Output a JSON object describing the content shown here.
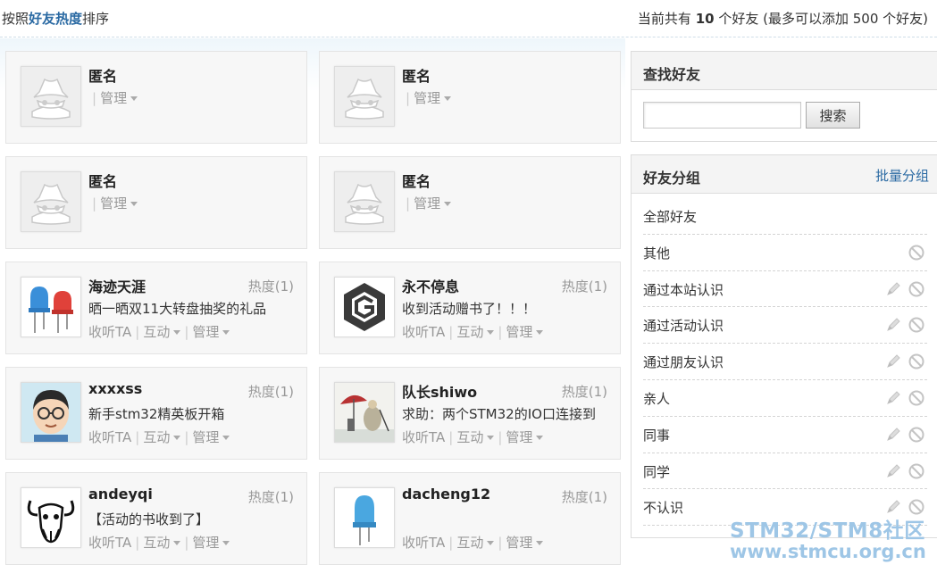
{
  "sort_bar": {
    "prefix": "按照",
    "highlight": "好友热度",
    "suffix": "排序",
    "count_prefix": "当前共有 ",
    "count": "10",
    "count_suffix": " 个好友 (最多可以添加 500 个好友)"
  },
  "labels": {
    "listen": "收听TA",
    "interact": "互动",
    "manage": "管理"
  },
  "friends": [
    {
      "name": "匿名",
      "heat": "",
      "status": "",
      "avatar": "anonymous-icon"
    },
    {
      "name": "匿名",
      "heat": "",
      "status": "",
      "avatar": "anonymous-icon"
    },
    {
      "name": "匿名",
      "heat": "",
      "status": "",
      "avatar": "anonymous-icon"
    },
    {
      "name": "匿名",
      "heat": "",
      "status": "",
      "avatar": "anonymous-icon"
    },
    {
      "name": "海迹天涯",
      "heat": "热度(1)",
      "status": "晒一晒双11大转盘抽奖的礼品",
      "avatar": "led-pair-icon"
    },
    {
      "name": "永不停息",
      "heat": "热度(1)",
      "status": "收到活动赠书了！！！",
      "avatar": "g-logo-icon"
    },
    {
      "name": "xxxxss",
      "heat": "热度(1)",
      "status": "新手stm32精英板开箱",
      "avatar": "cartoon-face-icon"
    },
    {
      "name": "队长shiwo",
      "heat": "热度(1)",
      "status": "求助：两个STM32的IO口连接到",
      "avatar": "umbrella-scene-icon"
    },
    {
      "name": "andeyqi",
      "heat": "热度(1)",
      "status": "【活动的书收到了】",
      "avatar": "gnu-icon"
    },
    {
      "name": "dacheng12",
      "heat": "热度(1)",
      "status": "",
      "avatar": "blue-led-icon"
    }
  ],
  "search_panel": {
    "title": "查找好友",
    "input_value": "",
    "button_label": "搜索"
  },
  "groups_panel": {
    "title": "好友分组",
    "link": "批量分组",
    "items": [
      {
        "label": "全部好友",
        "edit": false,
        "remove": false
      },
      {
        "label": "其他",
        "edit": false,
        "remove": true
      },
      {
        "label": "通过本站认识",
        "edit": true,
        "remove": true
      },
      {
        "label": "通过活动认识",
        "edit": true,
        "remove": true
      },
      {
        "label": "通过朋友认识",
        "edit": true,
        "remove": true
      },
      {
        "label": "亲人",
        "edit": true,
        "remove": true
      },
      {
        "label": "同事",
        "edit": true,
        "remove": true
      },
      {
        "label": "同学",
        "edit": true,
        "remove": true
      },
      {
        "label": "不认识",
        "edit": true,
        "remove": true
      }
    ]
  },
  "watermark": {
    "line1": "STM32/STM8社区",
    "line2": "www.stmcu.org.cn"
  }
}
